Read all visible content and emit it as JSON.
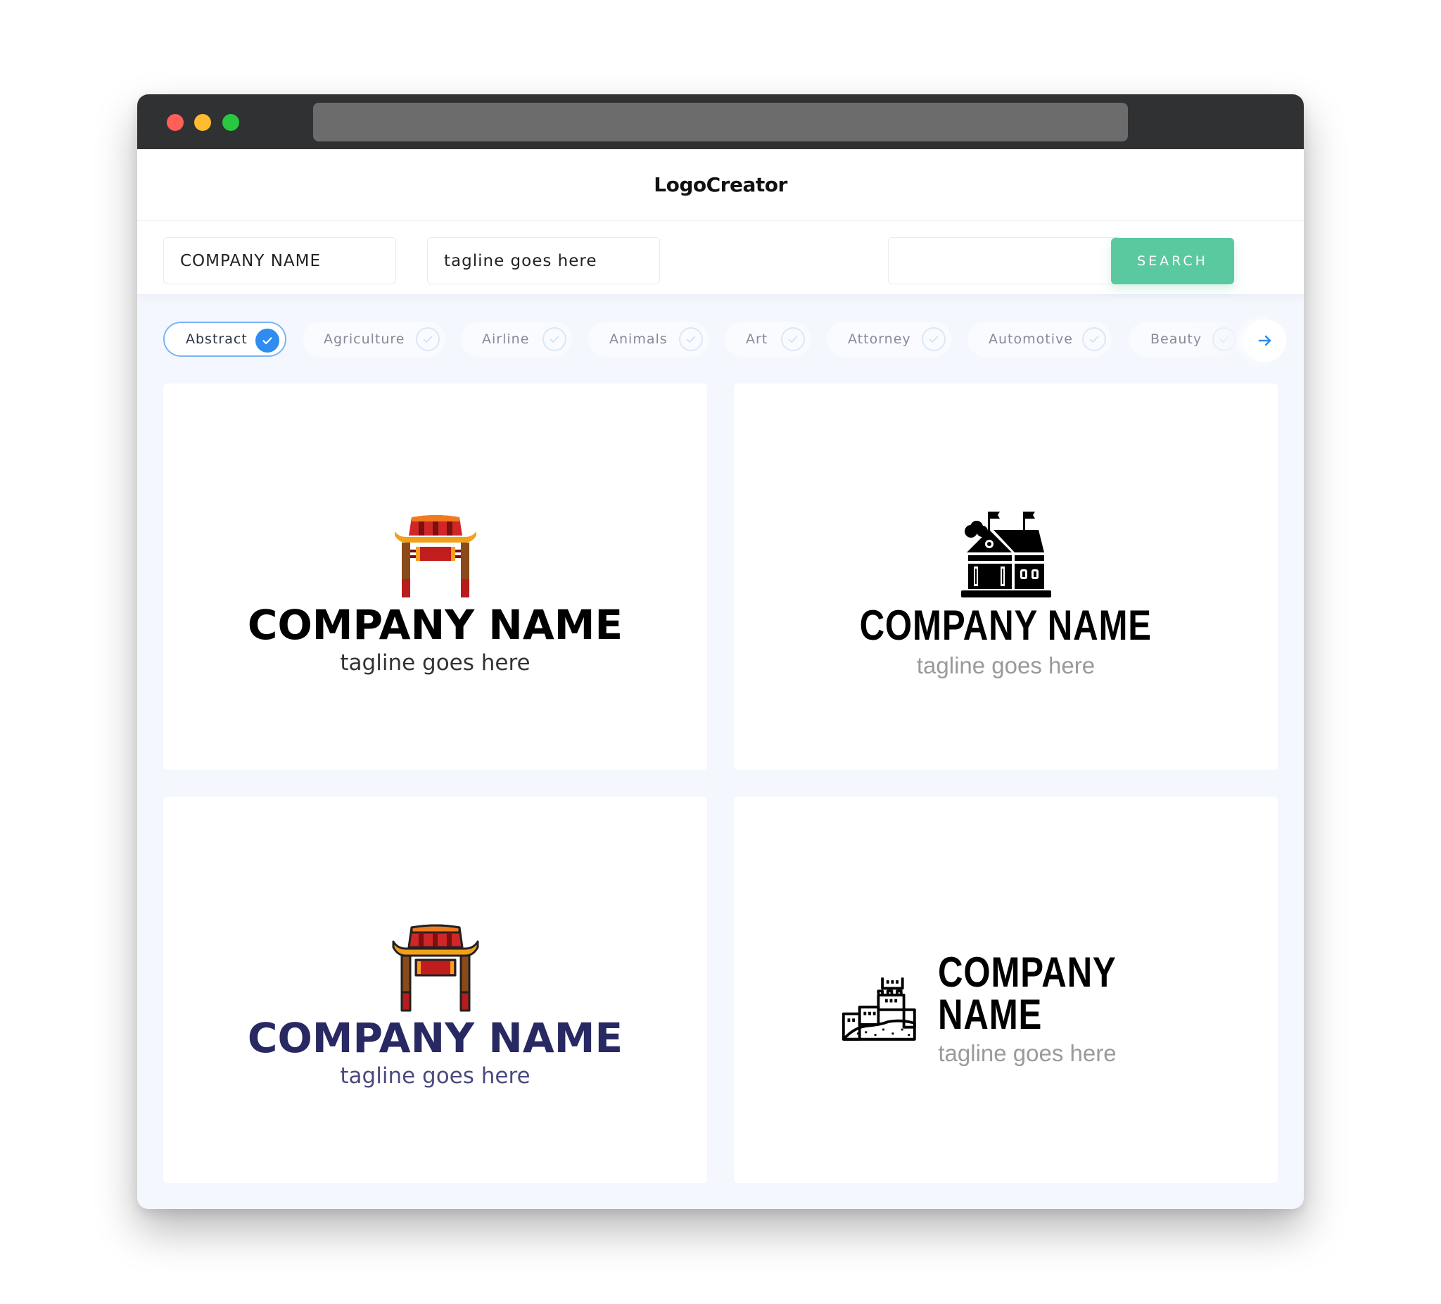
{
  "browser": {
    "traffic_lights": [
      "close",
      "minimize",
      "maximize"
    ]
  },
  "header": {
    "brand": "LogoCreator"
  },
  "search": {
    "company_name_value": "COMPANY NAME",
    "tagline_value": "tagline goes here",
    "keyword_value": "",
    "search_label": "SEARCH",
    "accent_color": "#5bc9a0"
  },
  "categories": {
    "items": [
      {
        "label": "Abstract",
        "selected": true
      },
      {
        "label": "Agriculture",
        "selected": false
      },
      {
        "label": "Airline",
        "selected": false
      },
      {
        "label": "Animals",
        "selected": false
      },
      {
        "label": "Art",
        "selected": false
      },
      {
        "label": "Attorney",
        "selected": false
      },
      {
        "label": "Automotive",
        "selected": false
      },
      {
        "label": "Beauty",
        "selected": false
      }
    ],
    "next_icon": "arrow-right-icon",
    "selected_color": "#2f8cf0"
  },
  "logos": [
    {
      "icon": "chinese-gate-icon",
      "company": "COMPANY NAME",
      "tagline": "tagline goes here",
      "text_color": "#000000",
      "tagline_color": "#333333",
      "layout": "stacked"
    },
    {
      "icon": "school-building-icon",
      "company": "COMPANY NAME",
      "tagline": "tagline goes here",
      "text_color": "#000000",
      "tagline_color": "#9a9a9a",
      "layout": "stacked"
    },
    {
      "icon": "chinese-gate-outline-icon",
      "company": "COMPANY NAME",
      "tagline": "tagline goes here",
      "text_color": "#282862",
      "tagline_color": "#4a4a80",
      "layout": "stacked"
    },
    {
      "icon": "great-wall-icon",
      "company": "COMPANY NAME",
      "tagline": "tagline goes here",
      "text_color": "#000000",
      "tagline_color": "#9a9a9a",
      "layout": "inline"
    }
  ]
}
